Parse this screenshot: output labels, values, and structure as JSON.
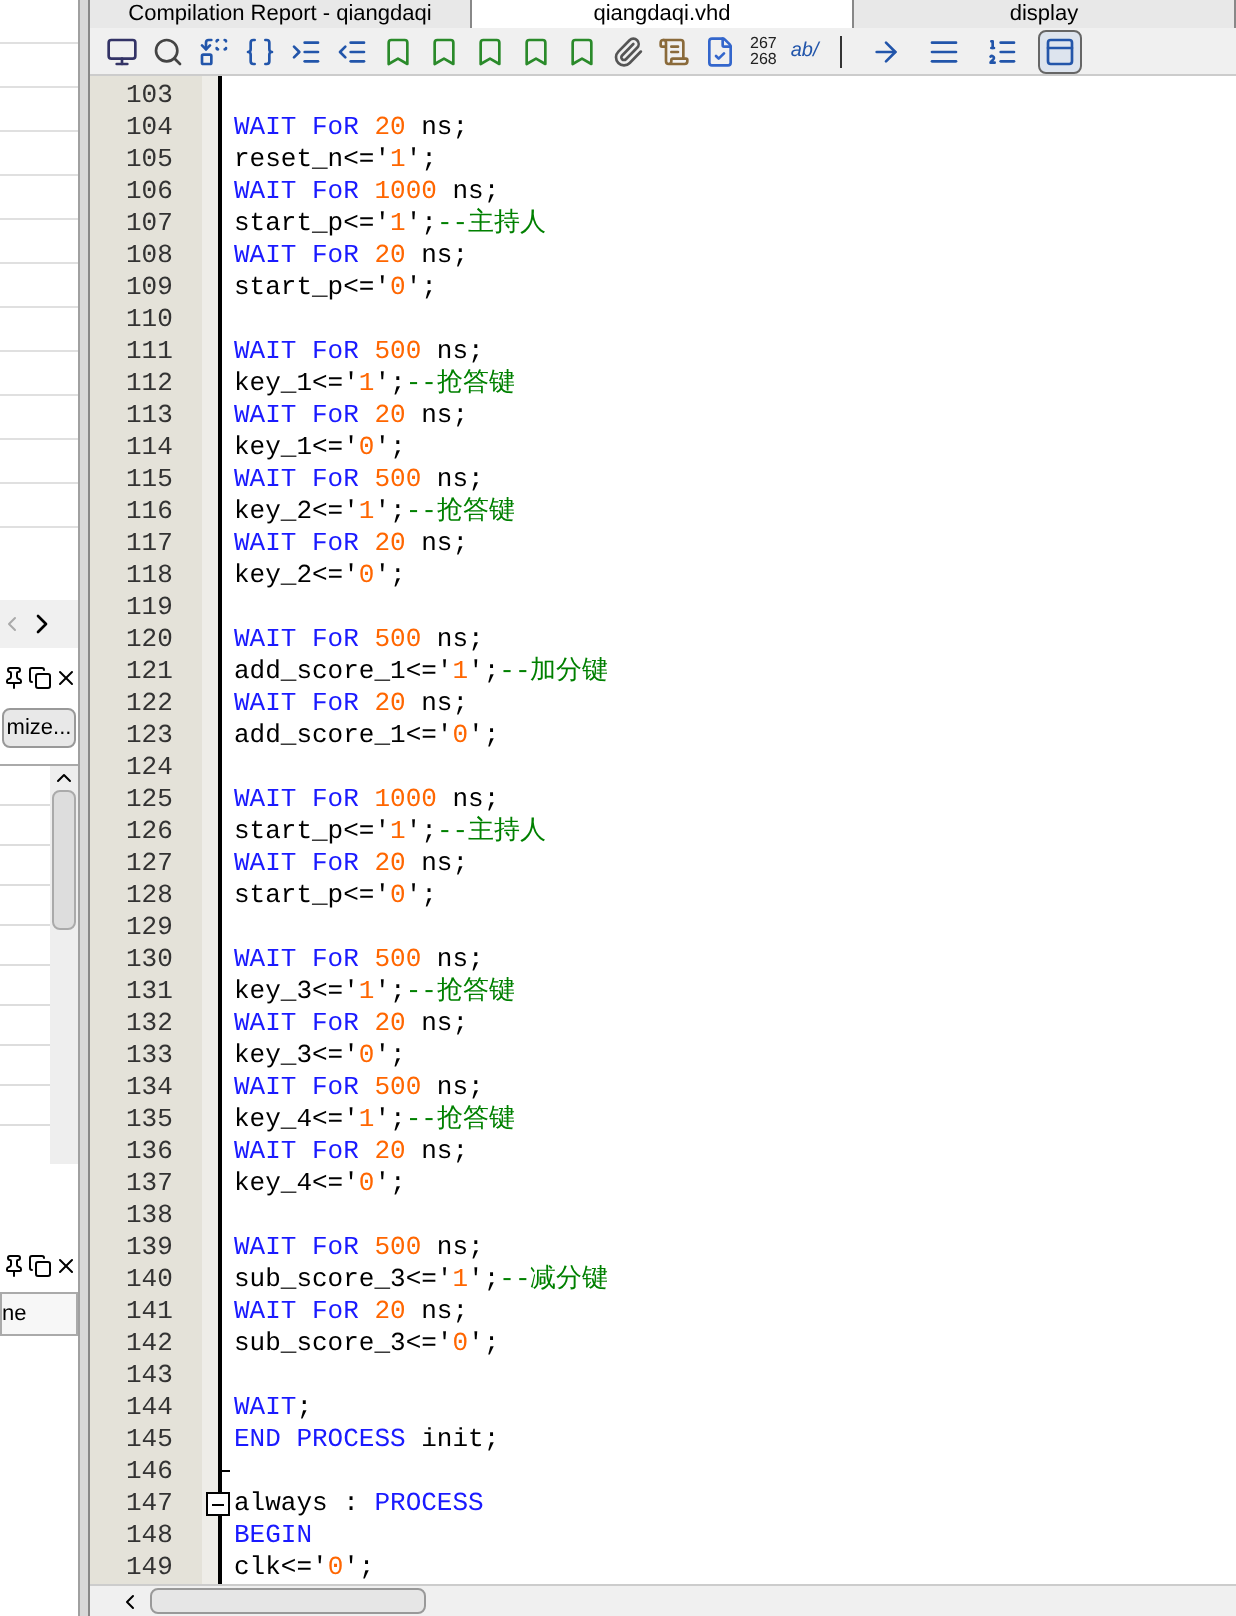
{
  "tabs": [
    {
      "label": "Compilation Report - qiangdaqi",
      "selected": false
    },
    {
      "label": "qiangdaqi.vhd",
      "selected": true
    },
    {
      "label": "display",
      "selected": false
    }
  ],
  "toolbar": {
    "line_numbers_icon": [
      "267",
      "268"
    ],
    "spell_icon": "ab/",
    "toggles": [
      {
        "kind": "arrow",
        "on": false
      },
      {
        "kind": "lines",
        "on": false
      },
      {
        "kind": "lines-num",
        "on": false
      },
      {
        "kind": "panel",
        "on": true
      }
    ]
  },
  "left_panel": {
    "customize_button": "mize...",
    "column_header": "ne"
  },
  "editor": {
    "lines": [
      {
        "num": "103"
      },
      {
        "num": "104",
        "tokens": [
          {
            "kind": "kw",
            "text": "WAIT FoR "
          },
          {
            "kind": "num",
            "text": "20"
          },
          {
            "kind": "plain",
            "text": " ns;"
          }
        ]
      },
      {
        "num": "105",
        "tokens": [
          {
            "kind": "plain",
            "text": "reset_n<='"
          },
          {
            "kind": "num",
            "text": "1"
          },
          {
            "kind": "plain",
            "text": "';"
          }
        ]
      },
      {
        "num": "106",
        "tokens": [
          {
            "kind": "kw",
            "text": "WAIT FoR "
          },
          {
            "kind": "num",
            "text": "1000"
          },
          {
            "kind": "plain",
            "text": " ns;"
          }
        ]
      },
      {
        "num": "107",
        "tokens": [
          {
            "kind": "plain",
            "text": "start_p<='"
          },
          {
            "kind": "num",
            "text": "1"
          },
          {
            "kind": "plain",
            "text": "';"
          },
          {
            "kind": "comment",
            "text": "--主持人"
          }
        ]
      },
      {
        "num": "108",
        "tokens": [
          {
            "kind": "kw",
            "text": "WAIT FoR "
          },
          {
            "kind": "num",
            "text": "20"
          },
          {
            "kind": "plain",
            "text": " ns;"
          }
        ]
      },
      {
        "num": "109",
        "tokens": [
          {
            "kind": "plain",
            "text": "start_p<='"
          },
          {
            "kind": "num",
            "text": "0"
          },
          {
            "kind": "plain",
            "text": "';"
          }
        ]
      },
      {
        "num": "110"
      },
      {
        "num": "111",
        "tokens": [
          {
            "kind": "kw",
            "text": "WAIT FoR "
          },
          {
            "kind": "num",
            "text": "500"
          },
          {
            "kind": "plain",
            "text": " ns;"
          }
        ]
      },
      {
        "num": "112",
        "tokens": [
          {
            "kind": "plain",
            "text": "key_1<='"
          },
          {
            "kind": "num",
            "text": "1"
          },
          {
            "kind": "plain",
            "text": "';"
          },
          {
            "kind": "comment",
            "text": "--抢答键"
          }
        ]
      },
      {
        "num": "113",
        "tokens": [
          {
            "kind": "kw",
            "text": "WAIT FoR "
          },
          {
            "kind": "num",
            "text": "20"
          },
          {
            "kind": "plain",
            "text": " ns;"
          }
        ]
      },
      {
        "num": "114",
        "tokens": [
          {
            "kind": "plain",
            "text": "key_1<='"
          },
          {
            "kind": "num",
            "text": "0"
          },
          {
            "kind": "plain",
            "text": "';"
          }
        ]
      },
      {
        "num": "115",
        "tokens": [
          {
            "kind": "kw",
            "text": "WAIT FoR "
          },
          {
            "kind": "num",
            "text": "500"
          },
          {
            "kind": "plain",
            "text": " ns;"
          }
        ]
      },
      {
        "num": "116",
        "tokens": [
          {
            "kind": "plain",
            "text": "key_2<='"
          },
          {
            "kind": "num",
            "text": "1"
          },
          {
            "kind": "plain",
            "text": "';"
          },
          {
            "kind": "comment",
            "text": "--抢答键"
          }
        ]
      },
      {
        "num": "117",
        "tokens": [
          {
            "kind": "kw",
            "text": "WAIT FoR "
          },
          {
            "kind": "num",
            "text": "20"
          },
          {
            "kind": "plain",
            "text": " ns;"
          }
        ]
      },
      {
        "num": "118",
        "tokens": [
          {
            "kind": "plain",
            "text": "key_2<='"
          },
          {
            "kind": "num",
            "text": "0"
          },
          {
            "kind": "plain",
            "text": "';"
          }
        ]
      },
      {
        "num": "119"
      },
      {
        "num": "120",
        "tokens": [
          {
            "kind": "kw",
            "text": "WAIT FoR "
          },
          {
            "kind": "num",
            "text": "500"
          },
          {
            "kind": "plain",
            "text": " ns;"
          }
        ]
      },
      {
        "num": "121",
        "tokens": [
          {
            "kind": "plain",
            "text": "add_score_1<='"
          },
          {
            "kind": "num",
            "text": "1"
          },
          {
            "kind": "plain",
            "text": "';"
          },
          {
            "kind": "comment",
            "text": "--加分键"
          }
        ]
      },
      {
        "num": "122",
        "tokens": [
          {
            "kind": "kw",
            "text": "WAIT FoR "
          },
          {
            "kind": "num",
            "text": "20"
          },
          {
            "kind": "plain",
            "text": " ns;"
          }
        ]
      },
      {
        "num": "123",
        "tokens": [
          {
            "kind": "plain",
            "text": "add_score_1<='"
          },
          {
            "kind": "num",
            "text": "0"
          },
          {
            "kind": "plain",
            "text": "';"
          }
        ]
      },
      {
        "num": "124"
      },
      {
        "num": "125",
        "tokens": [
          {
            "kind": "kw",
            "text": "WAIT FoR "
          },
          {
            "kind": "num",
            "text": "1000"
          },
          {
            "kind": "plain",
            "text": " ns;"
          }
        ]
      },
      {
        "num": "126",
        "tokens": [
          {
            "kind": "plain",
            "text": "start_p<='"
          },
          {
            "kind": "num",
            "text": "1"
          },
          {
            "kind": "plain",
            "text": "';"
          },
          {
            "kind": "comment",
            "text": "--主持人"
          }
        ]
      },
      {
        "num": "127",
        "tokens": [
          {
            "kind": "kw",
            "text": "WAIT FoR "
          },
          {
            "kind": "num",
            "text": "20"
          },
          {
            "kind": "plain",
            "text": " ns;"
          }
        ]
      },
      {
        "num": "128",
        "tokens": [
          {
            "kind": "plain",
            "text": "start_p<='"
          },
          {
            "kind": "num",
            "text": "0"
          },
          {
            "kind": "plain",
            "text": "';"
          }
        ]
      },
      {
        "num": "129"
      },
      {
        "num": "130",
        "tokens": [
          {
            "kind": "kw",
            "text": "WAIT FoR "
          },
          {
            "kind": "num",
            "text": "500"
          },
          {
            "kind": "plain",
            "text": " ns;"
          }
        ]
      },
      {
        "num": "131",
        "tokens": [
          {
            "kind": "plain",
            "text": "key_3<='"
          },
          {
            "kind": "num",
            "text": "1"
          },
          {
            "kind": "plain",
            "text": "';"
          },
          {
            "kind": "comment",
            "text": "--抢答键"
          }
        ]
      },
      {
        "num": "132",
        "tokens": [
          {
            "kind": "kw",
            "text": "WAIT FoR "
          },
          {
            "kind": "num",
            "text": "20"
          },
          {
            "kind": "plain",
            "text": " ns;"
          }
        ]
      },
      {
        "num": "133",
        "tokens": [
          {
            "kind": "plain",
            "text": "key_3<='"
          },
          {
            "kind": "num",
            "text": "0"
          },
          {
            "kind": "plain",
            "text": "';"
          }
        ]
      },
      {
        "num": "134",
        "tokens": [
          {
            "kind": "kw",
            "text": "WAIT FoR "
          },
          {
            "kind": "num",
            "text": "500"
          },
          {
            "kind": "plain",
            "text": " ns;"
          }
        ]
      },
      {
        "num": "135",
        "tokens": [
          {
            "kind": "plain",
            "text": "key_4<='"
          },
          {
            "kind": "num",
            "text": "1"
          },
          {
            "kind": "plain",
            "text": "';"
          },
          {
            "kind": "comment",
            "text": "--抢答键"
          }
        ]
      },
      {
        "num": "136",
        "tokens": [
          {
            "kind": "kw",
            "text": "WAIT FoR "
          },
          {
            "kind": "num",
            "text": "20"
          },
          {
            "kind": "plain",
            "text": " ns;"
          }
        ]
      },
      {
        "num": "137",
        "tokens": [
          {
            "kind": "plain",
            "text": "key_4<='"
          },
          {
            "kind": "num",
            "text": "0"
          },
          {
            "kind": "plain",
            "text": "';"
          }
        ]
      },
      {
        "num": "138"
      },
      {
        "num": "139",
        "tokens": [
          {
            "kind": "kw",
            "text": "WAIT FoR "
          },
          {
            "kind": "num",
            "text": "500"
          },
          {
            "kind": "plain",
            "text": " ns;"
          }
        ]
      },
      {
        "num": "140",
        "tokens": [
          {
            "kind": "plain",
            "text": "sub_score_3<='"
          },
          {
            "kind": "num",
            "text": "1"
          },
          {
            "kind": "plain",
            "text": "';"
          },
          {
            "kind": "comment",
            "text": "--减分键"
          }
        ]
      },
      {
        "num": "141",
        "tokens": [
          {
            "kind": "kw",
            "text": "WAIT FoR "
          },
          {
            "kind": "num",
            "text": "20"
          },
          {
            "kind": "plain",
            "text": " ns;"
          }
        ]
      },
      {
        "num": "142",
        "tokens": [
          {
            "kind": "plain",
            "text": "sub_score_3<='"
          },
          {
            "kind": "num",
            "text": "0"
          },
          {
            "kind": "plain",
            "text": "';"
          }
        ]
      },
      {
        "num": "143"
      },
      {
        "num": "144",
        "tokens": [
          {
            "kind": "kw",
            "text": "WAIT"
          },
          {
            "kind": "plain",
            "text": ";"
          }
        ]
      },
      {
        "num": "145",
        "tokens": [
          {
            "kind": "kw",
            "text": "END PROCESS"
          },
          {
            "kind": "plain",
            "text": " init;"
          }
        ]
      },
      {
        "num": "146",
        "fold_end": true
      },
      {
        "num": "147",
        "collapsible": true,
        "tokens": [
          {
            "kind": "plain",
            "text": "always : "
          },
          {
            "kind": "kw",
            "text": "PROCESS"
          }
        ]
      },
      {
        "num": "148",
        "tokens": [
          {
            "kind": "kw",
            "text": "BEGIN"
          }
        ]
      },
      {
        "num": "149",
        "tokens": [
          {
            "kind": "plain",
            "text": "clk<='"
          },
          {
            "kind": "num",
            "text": "0"
          },
          {
            "kind": "plain",
            "text": "';"
          }
        ]
      }
    ]
  }
}
